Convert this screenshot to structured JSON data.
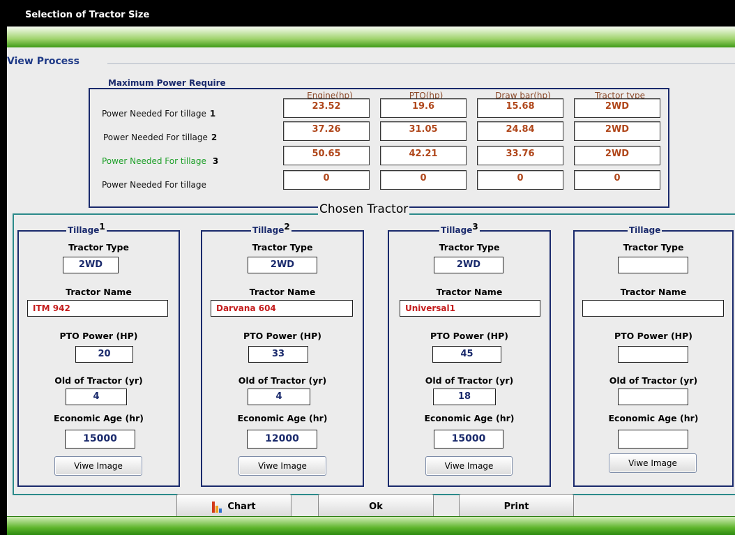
{
  "window": {
    "title": "Selection of Tractor Size"
  },
  "view_process": {
    "title": "View Process"
  },
  "max_power": {
    "title": "Maximum Power Require",
    "columns": [
      "Engine(hp)",
      "PTO(hp)",
      "Draw bar(hp)",
      "Tractor type"
    ],
    "rows": [
      {
        "label": "Power Needed For tillage",
        "num": "1",
        "values": [
          "23.52",
          "19.6",
          "15.68",
          "2WD"
        ]
      },
      {
        "label": "Power Needed For tillage",
        "num": "2",
        "values": [
          "37.26",
          "31.05",
          "24.84",
          "2WD"
        ]
      },
      {
        "label": "Power Needed For tillage",
        "num": "3",
        "values": [
          "50.65",
          "42.21",
          "33.76",
          "2WD"
        ]
      },
      {
        "label": "Power Needed For tillage",
        "num": "",
        "values": [
          "0",
          "0",
          "0",
          "0"
        ]
      }
    ]
  },
  "chosen": {
    "title": "Chosen Tractor",
    "field_labels": {
      "type": "Tractor Type",
      "name": "Tractor Name",
      "pto": "PTO Power (HP)",
      "old": "Old of Tractor (yr)",
      "econ": "Economic Age (hr)"
    },
    "view_button": "Viwe Image",
    "tillages": [
      {
        "title": "Tillage",
        "num": "1",
        "type": "2WD",
        "name": "ITM 942",
        "pto": "20",
        "old": "4",
        "econ": "15000"
      },
      {
        "title": "Tillage",
        "num": "2",
        "type": "2WD",
        "name": "Darvana 604",
        "pto": "33",
        "old": "4",
        "econ": "12000"
      },
      {
        "title": "Tillage",
        "num": "3",
        "type": "2WD",
        "name": "Universal1",
        "pto": "45",
        "old": "18",
        "econ": "15000"
      },
      {
        "title": "Tillage",
        "num": "",
        "type": "",
        "name": "",
        "pto": "",
        "old": "",
        "econ": ""
      }
    ]
  },
  "buttons": {
    "chart": "Chart",
    "ok": "Ok",
    "print": "Print"
  },
  "colors": {
    "accent": "#1a2a6c",
    "value_text": "#b0471b",
    "name_text": "#c41c1c",
    "highlight_row": "#1fa02a",
    "band_green": "#3f9b17"
  }
}
